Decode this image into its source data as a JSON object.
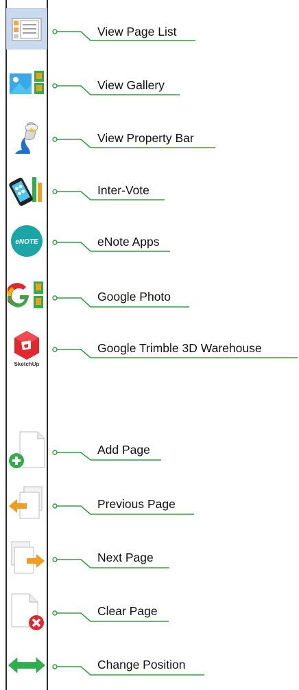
{
  "toolbar": {
    "items": [
      {
        "icon": "page-list-icon",
        "label": "View Page List",
        "selected": true
      },
      {
        "icon": "gallery-icon",
        "label": "View Gallery"
      },
      {
        "icon": "paint-bucket-icon",
        "label": "View Property Bar"
      },
      {
        "icon": "phone-vote-icon",
        "label": "Inter-Vote"
      },
      {
        "icon": "enote-logo-icon",
        "label": "eNote Apps",
        "icon_text": "eNOTE"
      },
      {
        "icon": "google-photo-icon",
        "label": "Google Photo"
      },
      {
        "icon": "sketchup-icon",
        "label": "Google Trimble 3D Warehouse",
        "icon_text": "SketchUp"
      },
      {
        "icon": "add-page-icon",
        "label": "Add Page"
      },
      {
        "icon": "previous-page-icon",
        "label": "Previous Page"
      },
      {
        "icon": "next-page-icon",
        "label": "Next Page"
      },
      {
        "icon": "clear-page-icon",
        "label": "Clear Page"
      },
      {
        "icon": "change-position-icon",
        "label": "Change Position"
      }
    ]
  },
  "colors": {
    "callout_line": "#2ea043",
    "selected_bg": "#c9d9ee",
    "accent_orange": "#f39c1f",
    "accent_green": "#2fae4b",
    "accent_red": "#e0282e",
    "enote_teal": "#1aa6a6"
  }
}
